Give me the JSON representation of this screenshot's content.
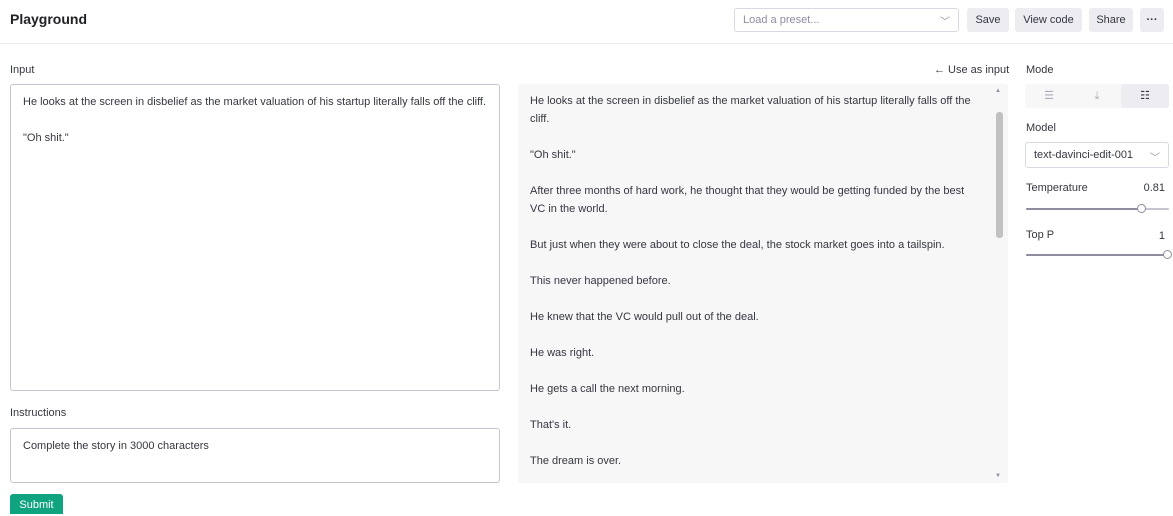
{
  "header": {
    "title": "Playground",
    "preset_placeholder": "Load a preset...",
    "save_label": "Save",
    "view_code_label": "View code",
    "share_label": "Share",
    "more_label": "···"
  },
  "input": {
    "label": "Input",
    "paragraphs": [
      "He looks at the screen in disbelief as the market valuation of his startup literally falls off the cliff.",
      "\"Oh shit.\""
    ]
  },
  "instructions": {
    "label": "Instructions",
    "value": "Complete the story in 3000 characters"
  },
  "submit_label": "Submit",
  "output": {
    "use_as_input_label": "← Use as input",
    "paragraphs": [
      "He looks at the screen in disbelief as the market valuation of his startup literally falls off the cliff.",
      "\"Oh shit.\"",
      "After three months of hard work, he thought that they would be getting funded by the best VC in the world.",
      "But just when they were about to close the deal, the stock market goes into a tailspin.",
      "This never happened before.",
      "He knew that the VC would pull out of the deal.",
      "He was right.",
      "He gets a call the next morning.",
      "That's it.",
      "The dream is over."
    ]
  },
  "sidebar": {
    "mode_label": "Mode",
    "modes": [
      {
        "icon": "complete-mode-icon",
        "glyph": "☰"
      },
      {
        "icon": "insert-mode-icon",
        "glyph": "⤓"
      },
      {
        "icon": "edit-mode-icon",
        "glyph": "☷"
      }
    ],
    "active_mode_index": 2,
    "model_label": "Model",
    "model_value": "text-davinci-edit-001",
    "temperature_label": "Temperature",
    "temperature_value": "0.81",
    "temperature_fraction": 0.81,
    "top_p_label": "Top P",
    "top_p_value": "1",
    "top_p_fraction": 1.0
  },
  "colors": {
    "accent": "#10a37f"
  }
}
